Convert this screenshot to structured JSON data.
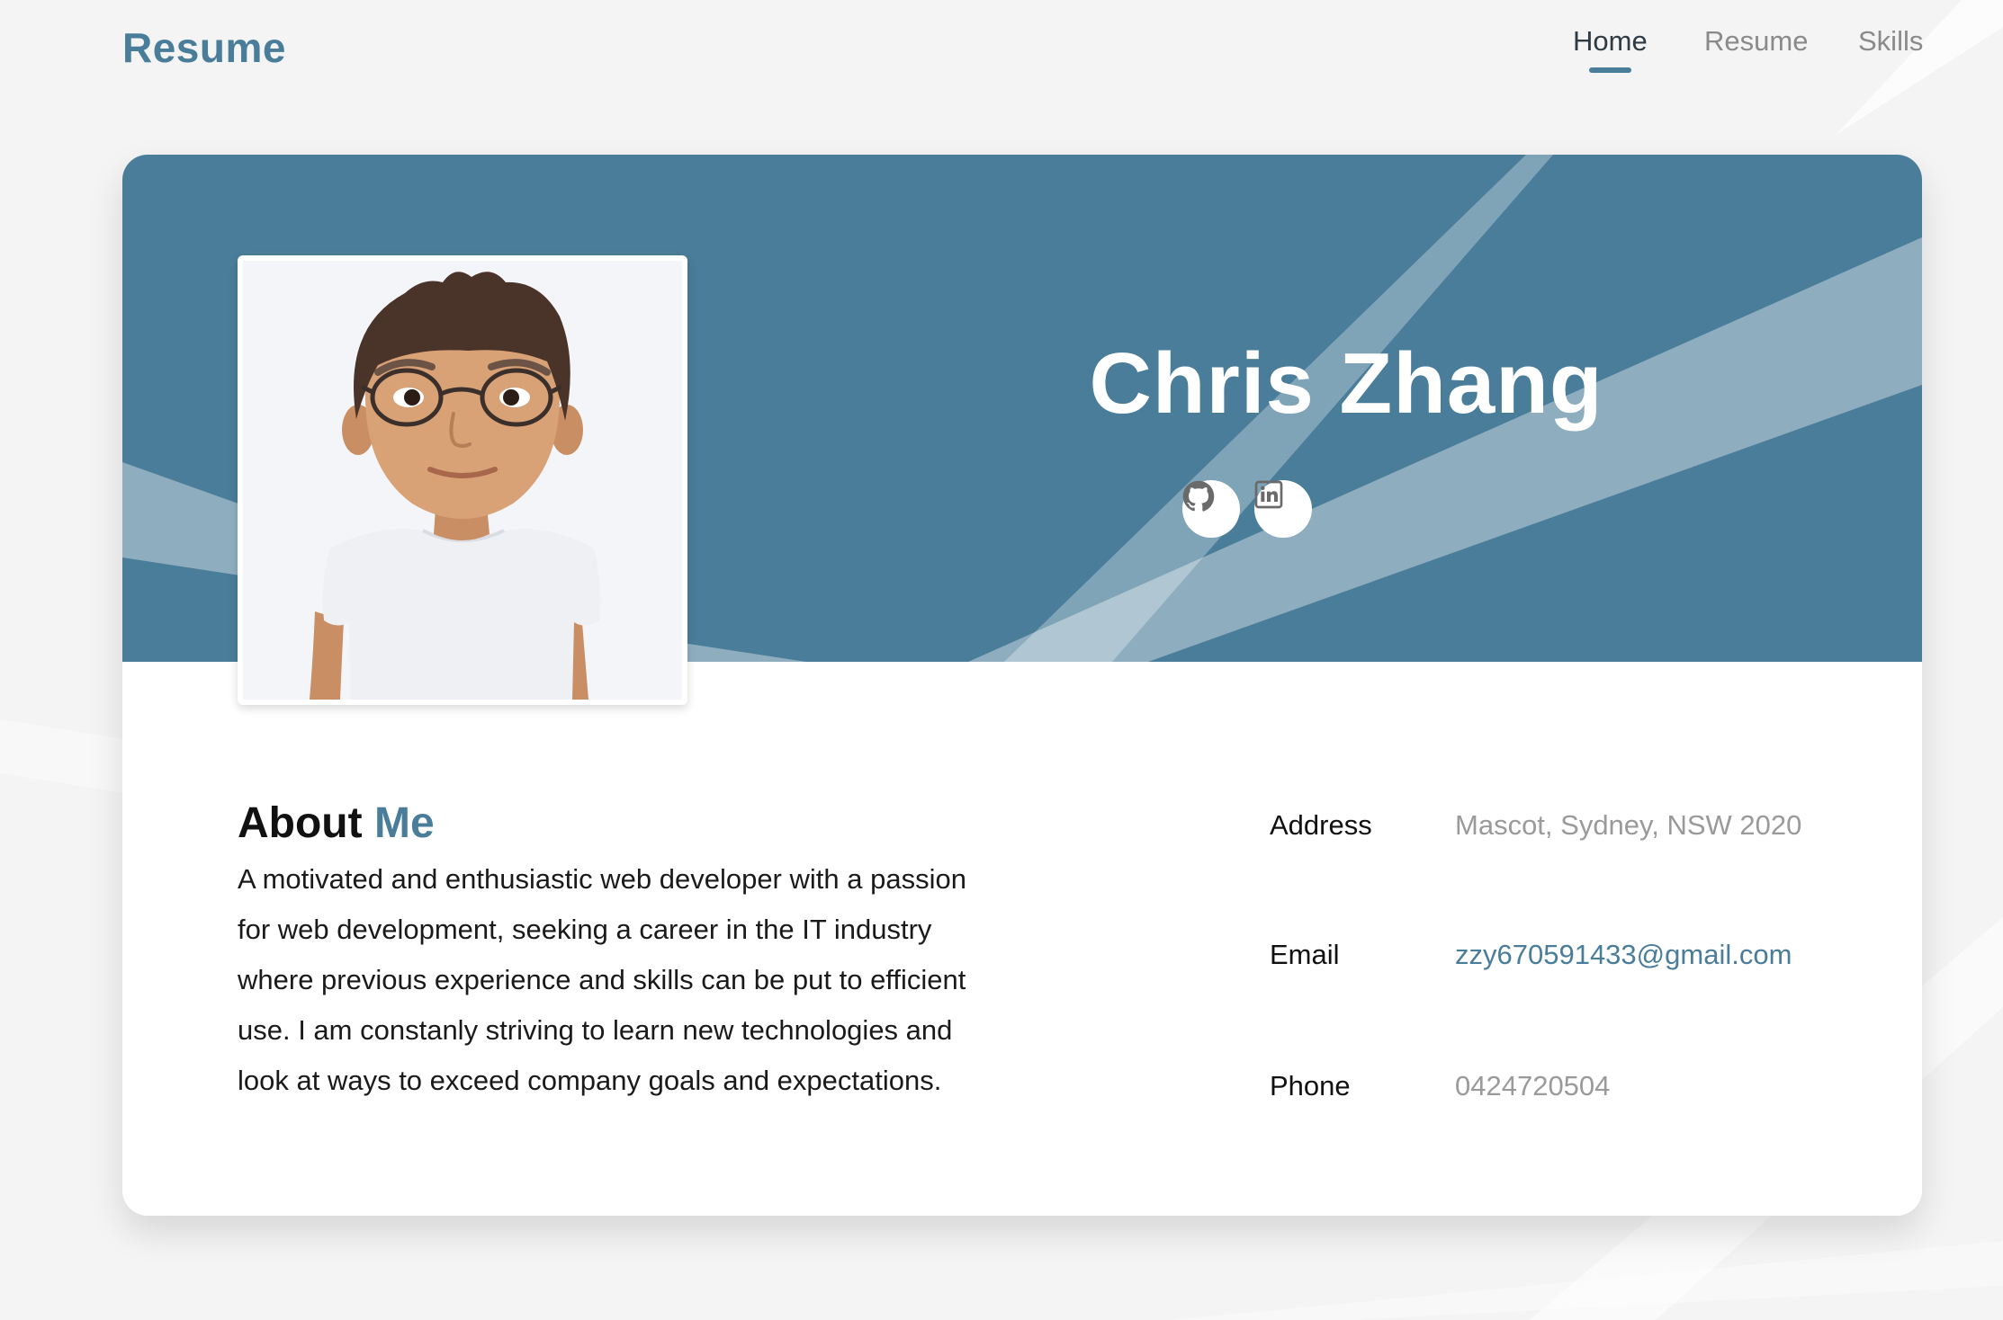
{
  "header": {
    "brand": "Resume",
    "nav": [
      {
        "label": "Home",
        "active": true
      },
      {
        "label": "Resume",
        "active": false
      },
      {
        "label": "Skills",
        "active": false
      }
    ]
  },
  "profile": {
    "name": "Chris Zhang",
    "social": [
      {
        "icon": "github-icon"
      },
      {
        "icon": "linkedin-icon"
      }
    ]
  },
  "about": {
    "title_part1": "About",
    "title_part2": "Me",
    "body": "A motivated and enthusiastic web developer with a passion for web development, seeking a career in the IT industry where previous experience and skills can be put to efficient use. I am constanly striving to learn new technologies and look at ways to exceed company goals and expectations."
  },
  "info": [
    {
      "label": "Address",
      "value": "Mascot, Sydney, NSW 2020"
    },
    {
      "label": "Email",
      "value": "zzy670591433@gmail.com"
    },
    {
      "label": "Phone",
      "value": "0424720504"
    }
  ],
  "colors": {
    "accent": "#4a7d99",
    "background": "#f4f4f4",
    "muted_text": "#9a9a9a"
  }
}
